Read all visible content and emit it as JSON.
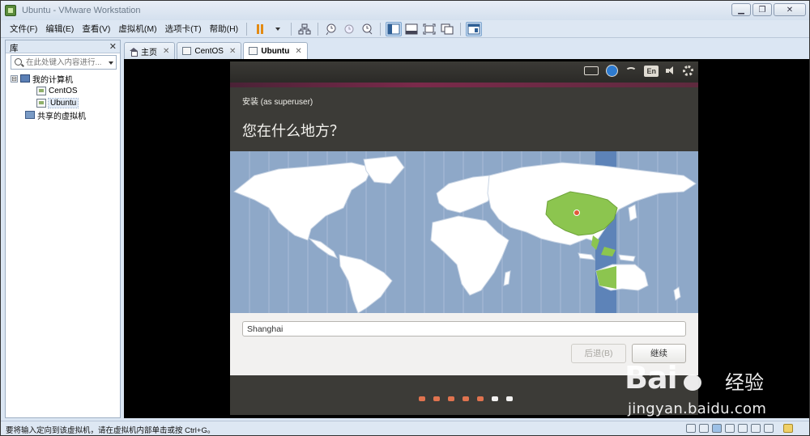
{
  "window": {
    "title": "Ubuntu - VMware Workstation"
  },
  "menu": [
    "文件(F)",
    "编辑(E)",
    "查看(V)",
    "虚拟机(M)",
    "选项卡(T)",
    "帮助(H)"
  ],
  "library": {
    "title": "库",
    "search_placeholder": "在此处键入内容进行...",
    "tree": [
      {
        "label": "我的计算机",
        "level": 0,
        "expander": "⊟",
        "icon": "computer-icon"
      },
      {
        "label": "CentOS",
        "level": 1,
        "icon": "vm-icon"
      },
      {
        "label": "Ubuntu",
        "level": 1,
        "icon": "vm-icon",
        "selected": true
      },
      {
        "label": "共享的虚拟机",
        "level": 0,
        "icon": "shared-vm-icon"
      }
    ]
  },
  "tabs": [
    {
      "label": "主页",
      "icon": "home-icon"
    },
    {
      "label": "CentOS",
      "icon": "vm-icon"
    },
    {
      "label": "Ubuntu",
      "icon": "vm-icon",
      "active": true
    }
  ],
  "installer": {
    "indicators": {
      "language": "En"
    },
    "subtitle": "安装 (as superuser)",
    "title": "您在什么地方？",
    "city_value": "Shanghai",
    "back_label": "后退(B)",
    "next_label": "继续",
    "progress_dots": [
      {
        "state": "done",
        "color": "#e0734f"
      },
      {
        "state": "done",
        "color": "#e0734f"
      },
      {
        "state": "done",
        "color": "#e0734f"
      },
      {
        "state": "done",
        "color": "#e0734f"
      },
      {
        "state": "current",
        "color": "#e0734f"
      },
      {
        "state": "todo",
        "color": "#f2f1f0"
      },
      {
        "state": "todo",
        "color": "#f2f1f0"
      }
    ],
    "colors": {
      "ocean": "#8ea8c8",
      "land": "#ffffff",
      "selected_region": "#8cc54f",
      "timezone_band": "#5d83b8",
      "header": "#3c3b37"
    }
  },
  "status": {
    "text": "要将输入定向到该虚拟机，请在虚拟机内部单击或按 Ctrl+G。"
  },
  "watermark": {
    "logo": "Bai",
    "cn": "经验",
    "url": "jingyan.baidu.com"
  }
}
